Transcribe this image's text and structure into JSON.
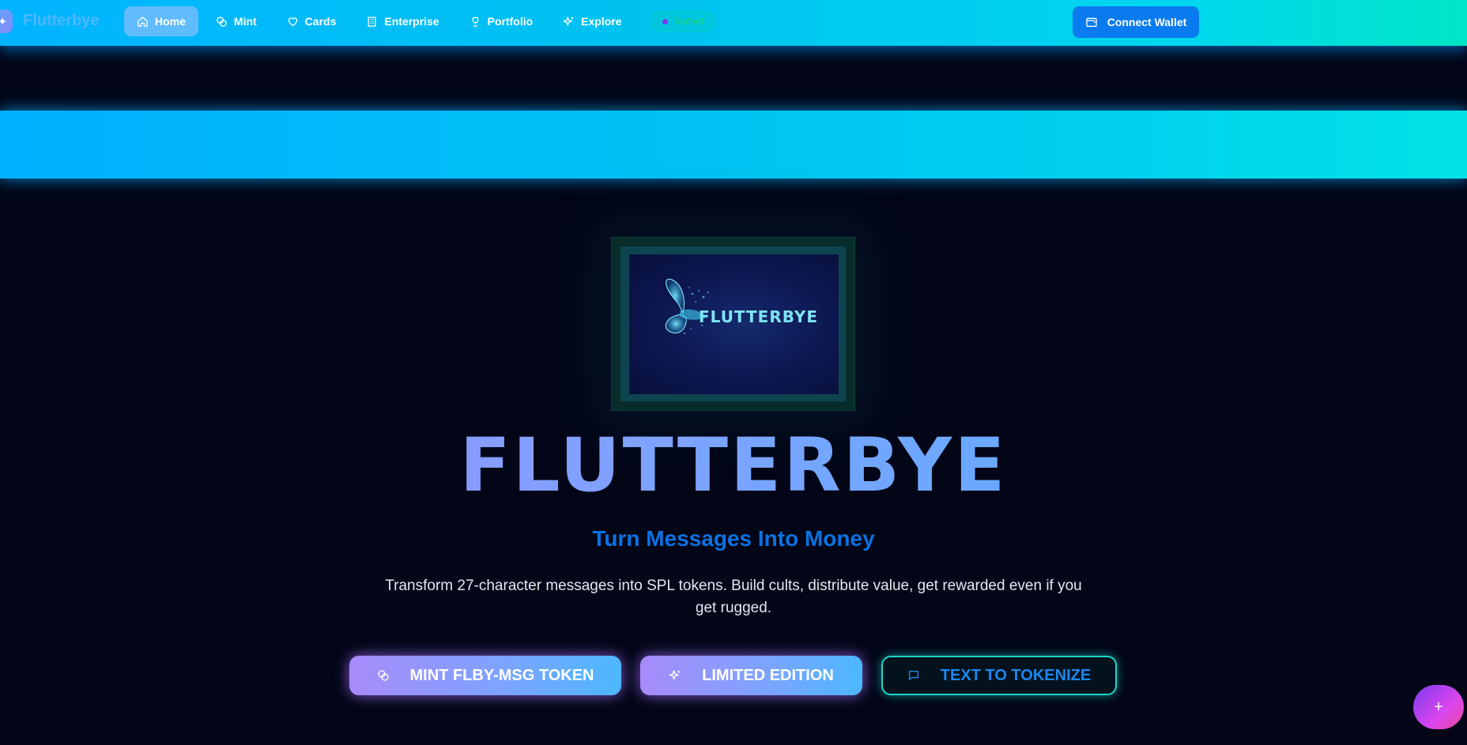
{
  "nav": {
    "brand": "Flutterbye",
    "items": [
      {
        "label": "Home",
        "icon": "home-icon",
        "active": true
      },
      {
        "label": "Mint",
        "icon": "coins-icon"
      },
      {
        "label": "Cards",
        "icon": "heart-icon"
      },
      {
        "label": "Enterprise",
        "icon": "building-icon"
      },
      {
        "label": "Portfolio",
        "icon": "trophy-icon"
      },
      {
        "label": "Explore",
        "icon": "sparkles-icon"
      }
    ],
    "network_badge": "Testnet",
    "connect_wallet": "Connect Wallet"
  },
  "hero": {
    "logo_text": "FLUTTERBYE",
    "title": "FLUTTERBYE",
    "subtitle": "Turn Messages Into Money",
    "description": "Transform 27-character messages into SPL tokens. Build cults, distribute value, get rewarded even if you get rugged.",
    "buttons": {
      "mint": "MINT FLBY-MSG TOKEN",
      "limited": "LIMITED EDITION",
      "tokenize": "TEXT TO TOKENIZE"
    }
  },
  "fab": {
    "label": "+"
  },
  "colors": {
    "nav_gradient_start": "#00b4ff",
    "nav_gradient_end": "#00e6c8",
    "page_background": "#020617",
    "subtitle": "#0b72e2",
    "outline_border": "#1fd3c6"
  }
}
